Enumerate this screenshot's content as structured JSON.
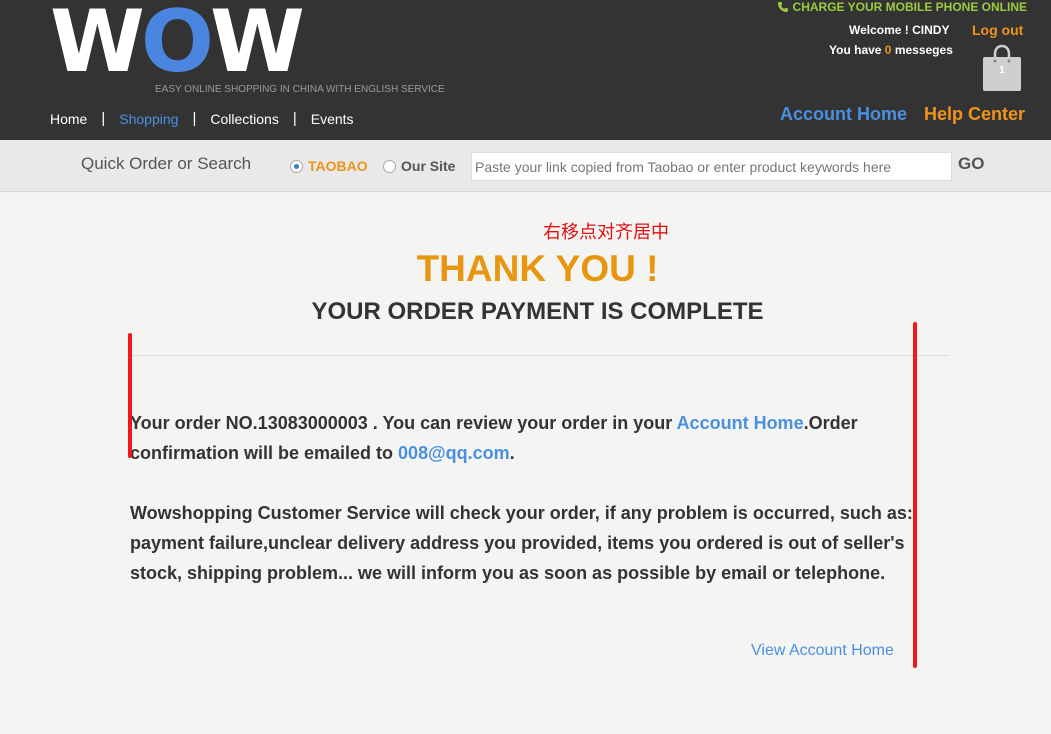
{
  "header": {
    "logo": {
      "text_before": "W",
      "text_o": "O",
      "text_after": "W"
    },
    "tagline": "EASY ONLINE SHOPPING IN CHINA WITH ENGLISH SERVICE",
    "nav": [
      {
        "label": "Home",
        "active": false
      },
      {
        "label": "Shopping",
        "active": true
      },
      {
        "label": "Collections",
        "active": false
      },
      {
        "label": "Events",
        "active": false
      }
    ],
    "nav_separator": "|",
    "charge_label": "CHARGE YOUR MOBILE PHONE ONLINE",
    "welcome": "Welcome ! CINDY",
    "logout": "Log out",
    "messages": {
      "prefix": "You have ",
      "count": "0",
      "suffix": " messeges"
    },
    "cart_count": "1",
    "account_home": "Account Home",
    "help_center": "Help Center"
  },
  "search": {
    "label": "Quick Order or Search",
    "options": [
      {
        "label": "TAOBAO",
        "checked": true
      },
      {
        "label": "Our Site",
        "checked": false
      }
    ],
    "placeholder": "Paste your link copied from Taobao or enter product keywords here",
    "go": "GO"
  },
  "content": {
    "annotation": "右移点对齐居中",
    "thank_you": "THANK YOU !",
    "subtitle": "YOUR ORDER PAYMENT IS COMPLETE",
    "para1": {
      "text1": "Your order NO.13083000003 . You can review your order in your ",
      "link1": "Account Home",
      "text2": ".Order confirmation will be emailed to ",
      "email": "008@qq.com",
      "text3": "."
    },
    "para2": "Wowshopping Customer Service will check your order, if any problem is occurred, such as: payment failure,unclear delivery address you provided, items you ordered is out of seller's stock, shipping problem... we will inform you as soon as possible by email or telephone.",
    "view_account": "View Account Home"
  },
  "colors": {
    "header_bg": "#333333",
    "accent_blue": "#4a90e2",
    "accent_orange": "#f0931a",
    "thank_you_orange": "#e8960f",
    "charge_green": "#9ccc3c",
    "annotation_red": "#e01010"
  }
}
